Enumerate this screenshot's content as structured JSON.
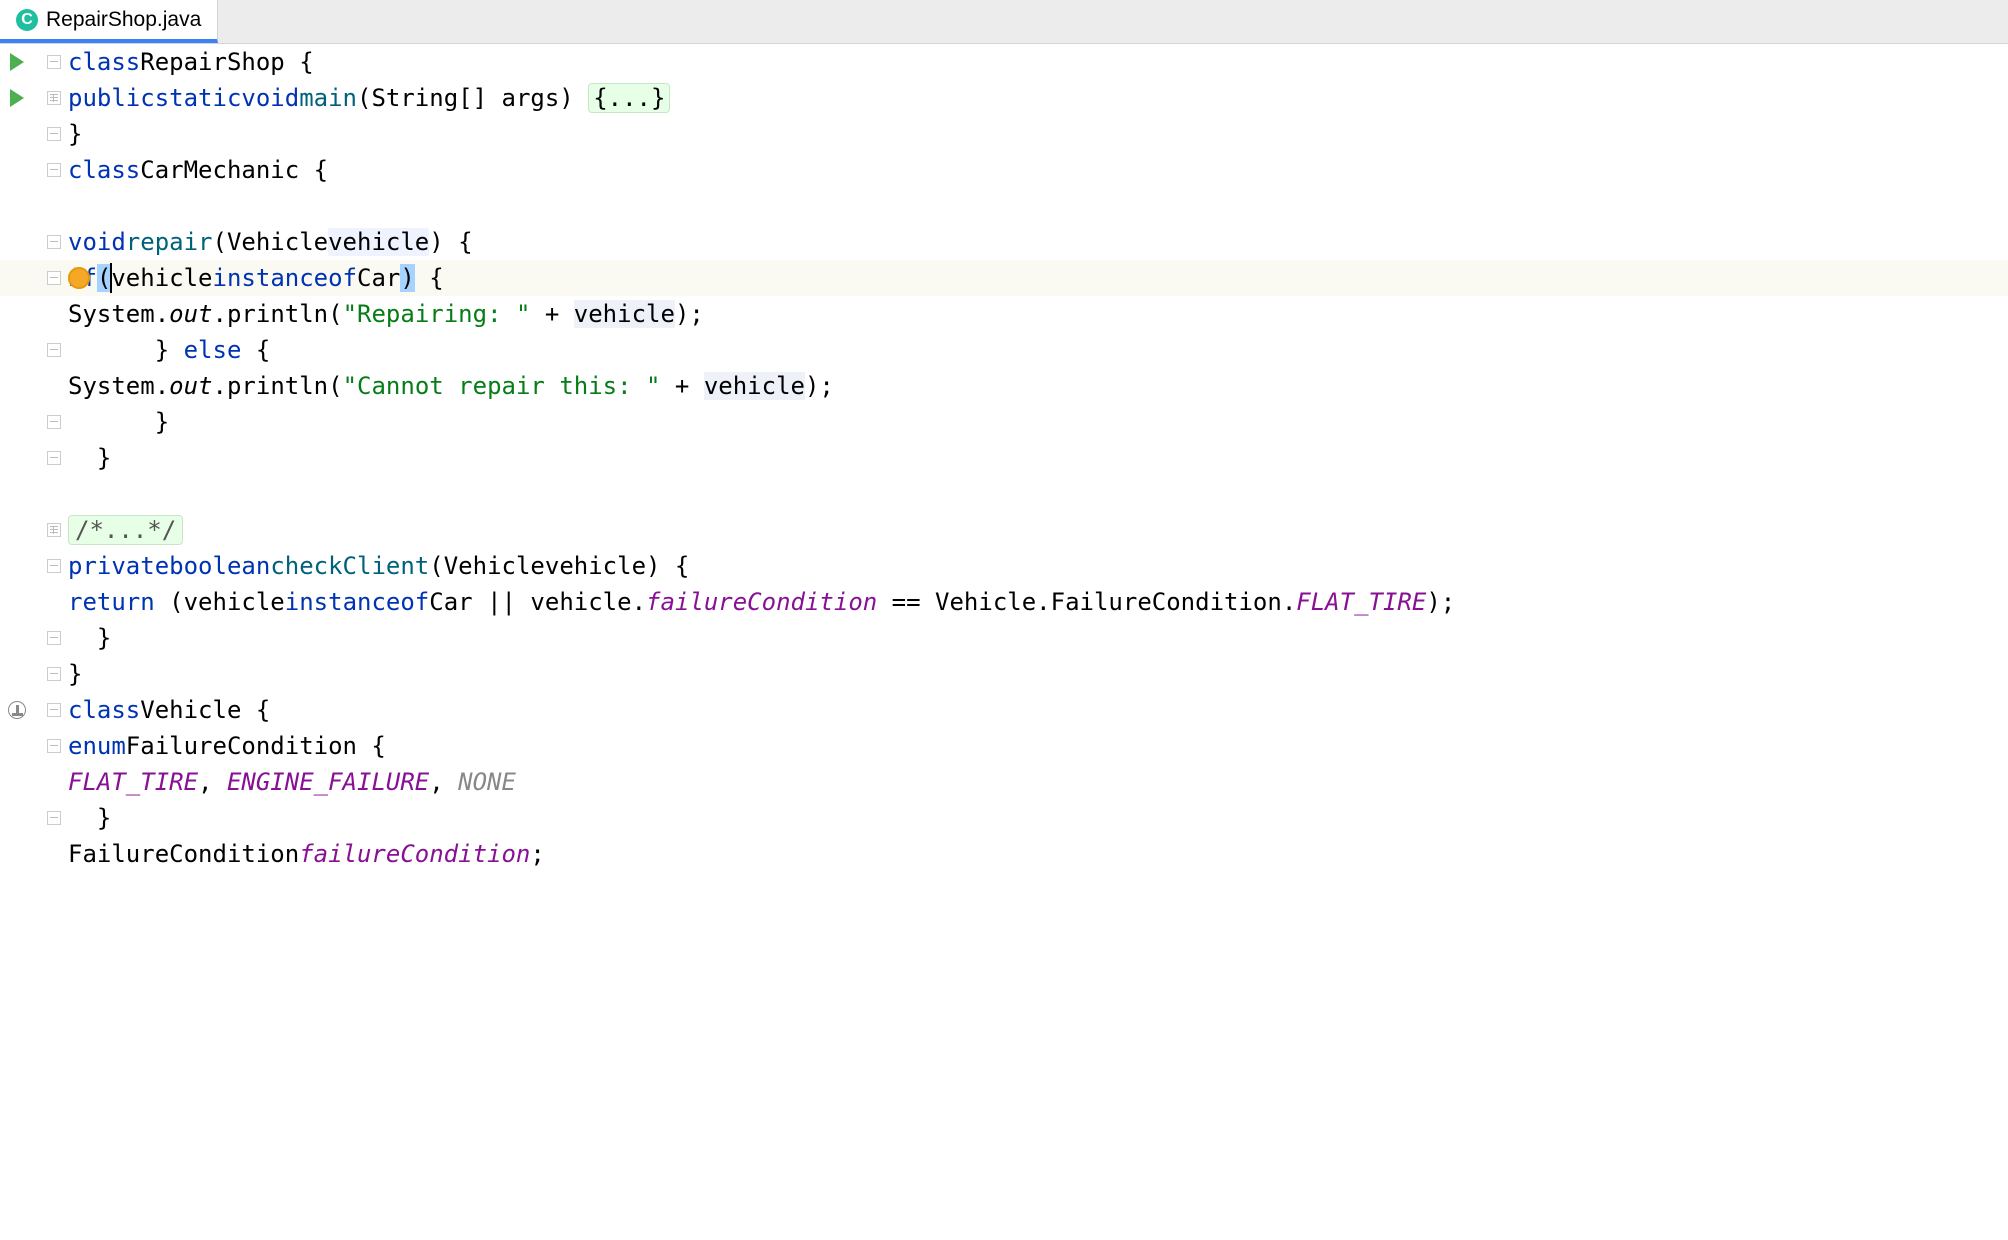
{
  "tab": {
    "icon_label": "C",
    "filename": "RepairShop.java"
  },
  "icons": {
    "run": "run-icon",
    "fold": "fold-handle",
    "bulb": "bulb-icon",
    "override": "override-icon"
  },
  "tokens": {
    "class": "class",
    "public": "public",
    "static": "static",
    "void": "void",
    "private": "private",
    "boolean": "boolean",
    "return": "return",
    "if": "if",
    "else": "else",
    "instanceof": "instanceof",
    "enum": "enum"
  },
  "names": {
    "RepairShop": "RepairShop",
    "main": "main",
    "String_arr_args": "String[] args",
    "CarMechanic": "CarMechanic",
    "repair": "repair",
    "Vehicle": "Vehicle",
    "vehicle": "vehicle",
    "Car": "Car",
    "System": "System",
    "out": "out",
    "println": "println",
    "checkClient": "checkClient",
    "failureCondition": "failureCondition",
    "FailureCondition": "FailureCondition",
    "FLAT_TIRE": "FLAT_TIRE",
    "ENGINE_FAILURE": "ENGINE_FAILURE",
    "NONE": "NONE"
  },
  "strings": {
    "repairing": "\"Repairing: \"",
    "cannot_repair": "\"Cannot repair this: \""
  },
  "folded": {
    "main_body": "{...}",
    "comment": "/*...*/"
  },
  "gutter": [
    {
      "run": true,
      "fold": "minus"
    },
    {
      "run": true,
      "fold": "plus"
    },
    {
      "fold": "end"
    },
    {
      "fold": "minus"
    },
    {
      "empty": true
    },
    {
      "fold": "minus"
    },
    {
      "bulb": true,
      "fold": "minus",
      "highlighted": true
    },
    {
      "empty": true
    },
    {
      "fold": "mid"
    },
    {
      "empty": true
    },
    {
      "fold": "end"
    },
    {
      "fold": "end"
    },
    {
      "empty": true
    },
    {
      "fold": "plus"
    },
    {
      "fold": "minus"
    },
    {
      "empty": true
    },
    {
      "fold": "end"
    },
    {
      "fold": "end"
    },
    {
      "override": true,
      "fold": "minus"
    },
    {
      "fold": "minus"
    },
    {
      "empty": true
    },
    {
      "fold": "end"
    },
    {
      "empty": true
    }
  ]
}
